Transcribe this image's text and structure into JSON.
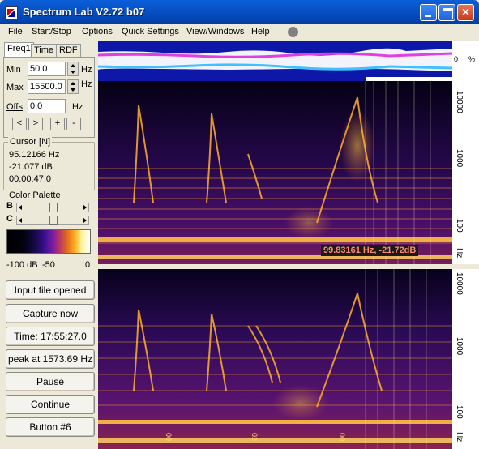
{
  "window": {
    "title": "Spectrum Lab V2.72 b07"
  },
  "menu": {
    "items": [
      {
        "label": "File"
      },
      {
        "label": "Start/Stop"
      },
      {
        "label": "Options"
      },
      {
        "label": "Quick Settings"
      },
      {
        "label": "View/Windows"
      },
      {
        "label": "Help"
      }
    ]
  },
  "tabs": [
    {
      "label": "Freq1"
    },
    {
      "label": "Time"
    },
    {
      "label": "RDF"
    }
  ],
  "freq": {
    "min_label": "Min",
    "min_value": "50.0",
    "min_unit": "Hz",
    "max_label": "Max",
    "max_value": "15500.0",
    "max_unit": "Hz",
    "offs_label": "Offs",
    "offs_value": "0.0",
    "offs_unit": "Hz",
    "buttons": [
      "<",
      ">",
      "+",
      "-"
    ]
  },
  "cursor": {
    "title": "Cursor [N]",
    "freq": "95.12166 Hz",
    "level": "-21.077 dB",
    "time": "00:00:47.0"
  },
  "palette": {
    "title": "Color Palette",
    "b_label": "B",
    "c_label": "C",
    "b_level": 0.5,
    "c_level": 0.5,
    "lbl_left": "-100 dB",
    "lbl_mid": "-50",
    "lbl_right": "0"
  },
  "buttons": [
    {
      "label": "Input file opened"
    },
    {
      "label": "Capture now"
    },
    {
      "label": "Time:  17:55:27.0"
    },
    {
      "label": "peak at 1573.69 Hz"
    },
    {
      "label": "Pause"
    },
    {
      "label": "Continue"
    },
    {
      "label": "Button #6"
    }
  ],
  "display": {
    "scope_zero": "0",
    "scope_pct": "%",
    "scale_labels": [
      "10000",
      "1000",
      "100",
      "Hz"
    ],
    "readout": "99.83161 Hz, -21.72dB",
    "time_marks": [
      "00",
      "02",
      "00"
    ]
  },
  "colors": {
    "scope_bg": "#0d18a8",
    "waterfall_dark": "#0a0220",
    "waterfall_warm": "#ffb020",
    "readout_text": "#ff8870"
  }
}
